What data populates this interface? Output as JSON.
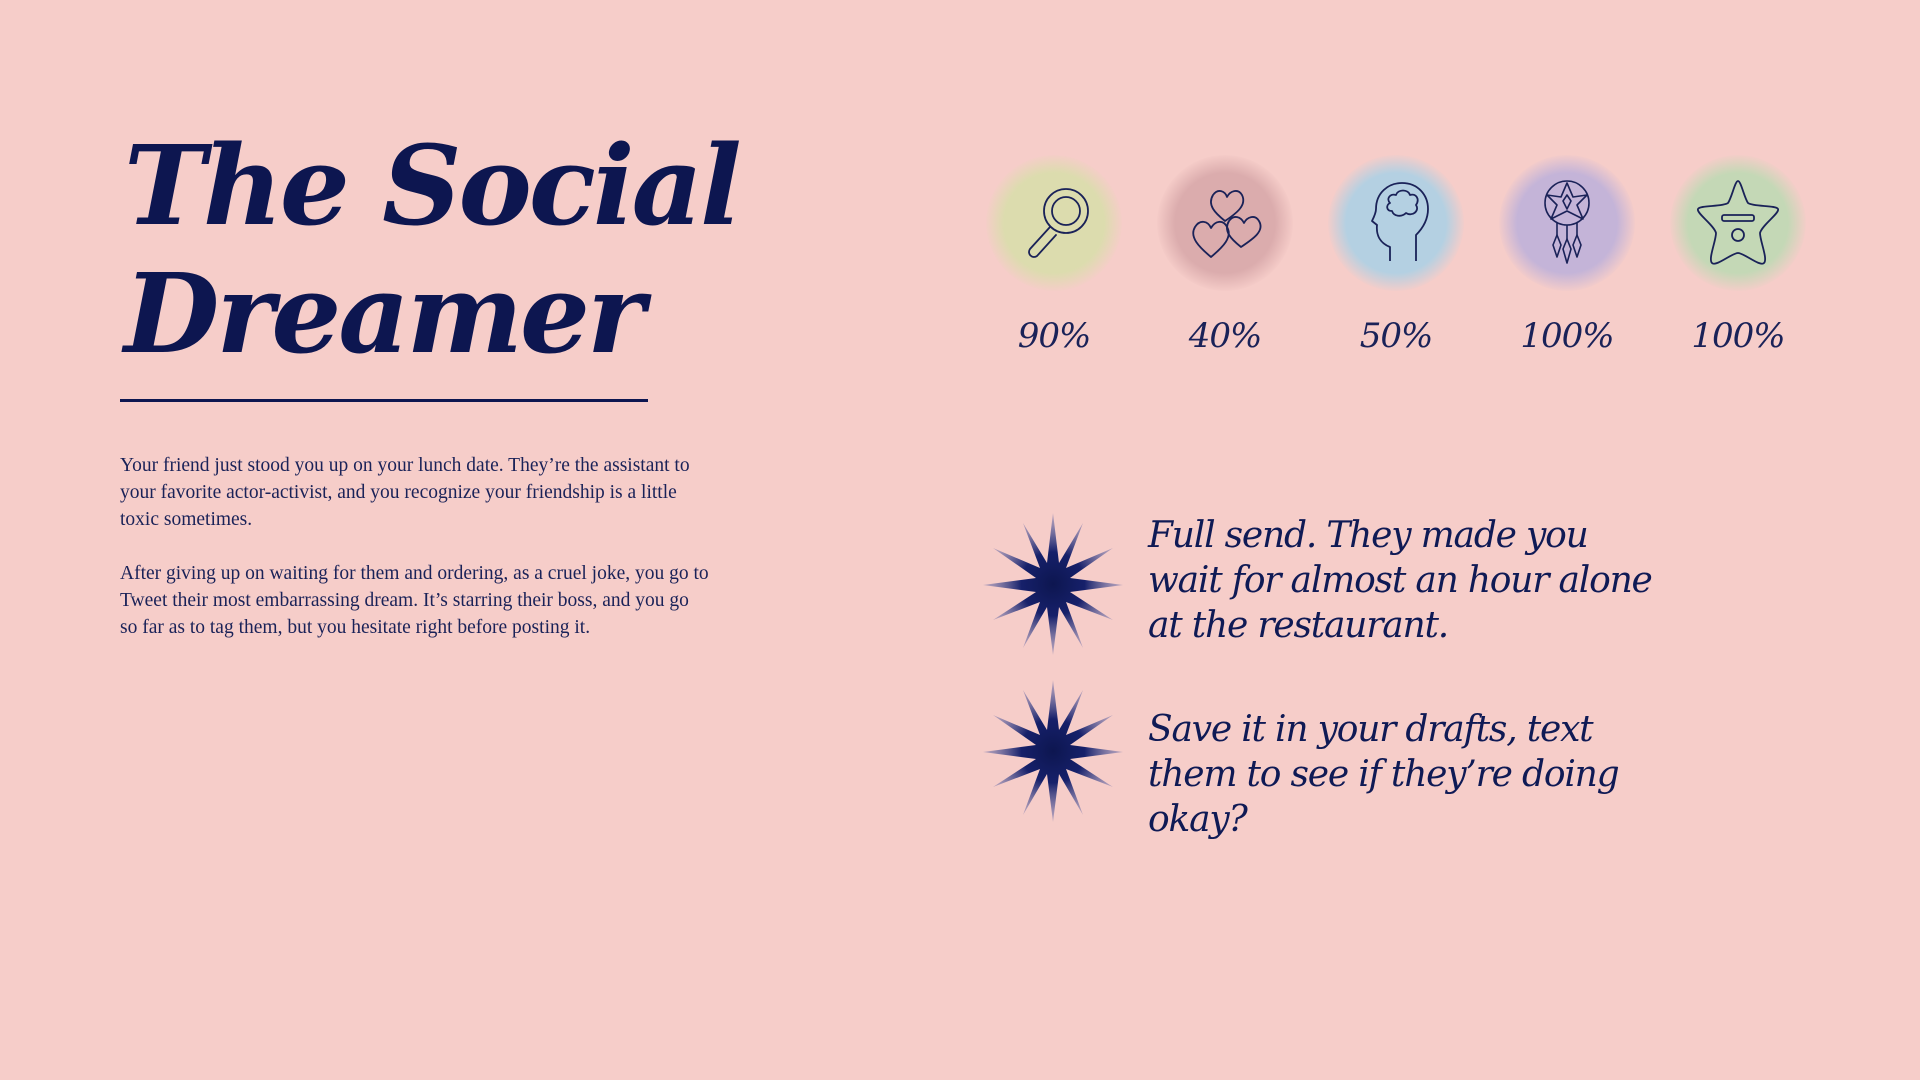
{
  "title": {
    "line1": "The Social",
    "line2": "Dreamer"
  },
  "description": {
    "paragraph1": "Your friend just stood you up on your lunch date. They’re the assistant to your favorite actor-activist, and you recognize your friendship is a little toxic sometimes.",
    "paragraph2": "After giving up on waiting for them and ordering, as a cruel joke, you go to Tweet their most embarrassing dream. It’s starring their boss, and you go so far as to tag them, but you hesitate right before posting it."
  },
  "stats": [
    {
      "icon": "magnifying-glass-icon",
      "value": "90%",
      "color": "#d9dcae"
    },
    {
      "icon": "hearts-icon",
      "value": "40%",
      "color": "#d9aeb0"
    },
    {
      "icon": "head-brain-icon",
      "value": "50%",
      "color": "#b2cfe0"
    },
    {
      "icon": "dreamcatcher-icon",
      "value": "100%",
      "color": "#c2b4d6"
    },
    {
      "icon": "star-badge-icon",
      "value": "100%",
      "color": "#c2d8b6"
    }
  ],
  "choices": [
    {
      "icon": "sparkle-star-icon",
      "text": "Full send. They made you wait for almost an hour alone at the restaurant."
    },
    {
      "icon": "sparkle-star-icon",
      "text": "Save it in your drafts, text them to see if they’re doing okay?"
    }
  ],
  "colors": {
    "background": "#f6cdc9",
    "ink": "#0f1a55"
  }
}
